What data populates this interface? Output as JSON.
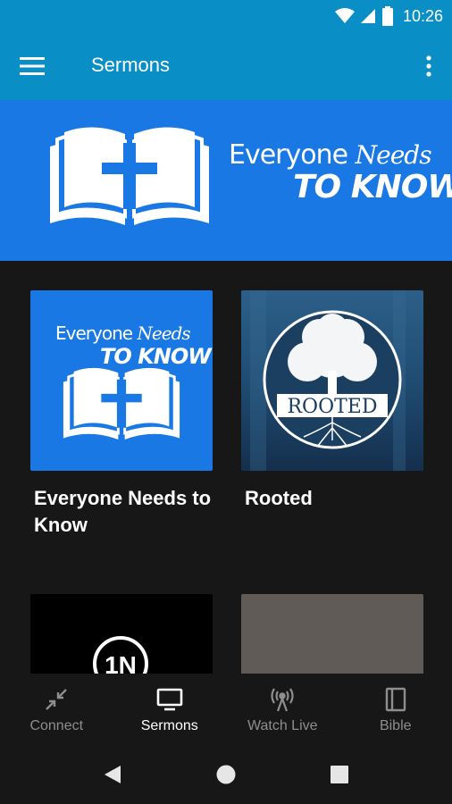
{
  "status_bar": {
    "time": "10:26"
  },
  "app_bar": {
    "title": "Sermons",
    "accent": "#0a8ec6"
  },
  "banner": {
    "line1_a": "Everyone",
    "line1_b": "Needs",
    "line2": "TO KNOW",
    "background": "#1a78e4"
  },
  "sermons": [
    {
      "title": "Everyone Needs to Know",
      "thumb_text_a": "Everyone",
      "thumb_text_b": "Needs",
      "thumb_text_c": "TO KNOW"
    },
    {
      "title": "Rooted",
      "thumb_text": "ROOTED"
    },
    {
      "title": "",
      "thumb_text": "1N"
    },
    {
      "title": ""
    }
  ],
  "bottom_nav": [
    {
      "label": "Connect",
      "icon": "collapse-arrows-icon",
      "active": false
    },
    {
      "label": "Sermons",
      "icon": "tv-icon",
      "active": true
    },
    {
      "label": "Watch Live",
      "icon": "broadcast-antenna-icon",
      "active": false
    },
    {
      "label": "Bible",
      "icon": "book-icon",
      "active": false
    }
  ],
  "system_nav": {
    "back": "back-icon",
    "home": "home-icon",
    "recents": "recents-icon"
  }
}
